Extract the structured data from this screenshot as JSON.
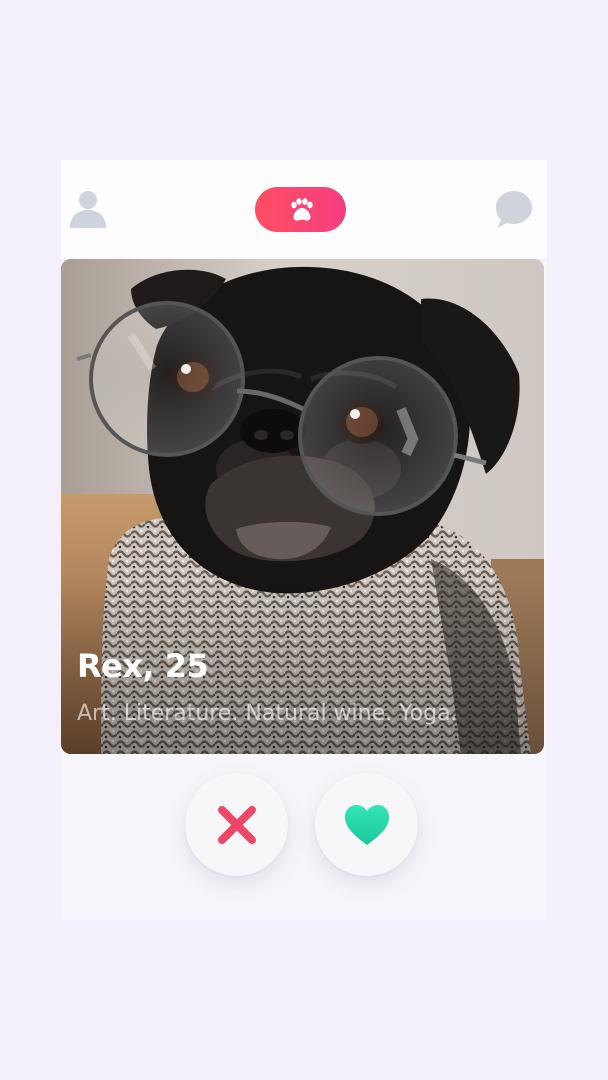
{
  "header": {
    "profile_icon": "user-icon",
    "center_icon": "paw-icon",
    "chat_icon": "chat-bubble-icon",
    "pill_gradient": [
      "#ff4e63",
      "#f43e80"
    ]
  },
  "card": {
    "name": "Rex, 25",
    "interests": "Art. Literature. Natural wine. Yoga.",
    "photo_subject": "pug-with-glasses"
  },
  "actions": {
    "nope": {
      "icon": "close-icon",
      "color": "#ec4766"
    },
    "like": {
      "icon": "heart-icon",
      "colors": [
        "#33e6b3",
        "#1cc79c"
      ]
    }
  }
}
